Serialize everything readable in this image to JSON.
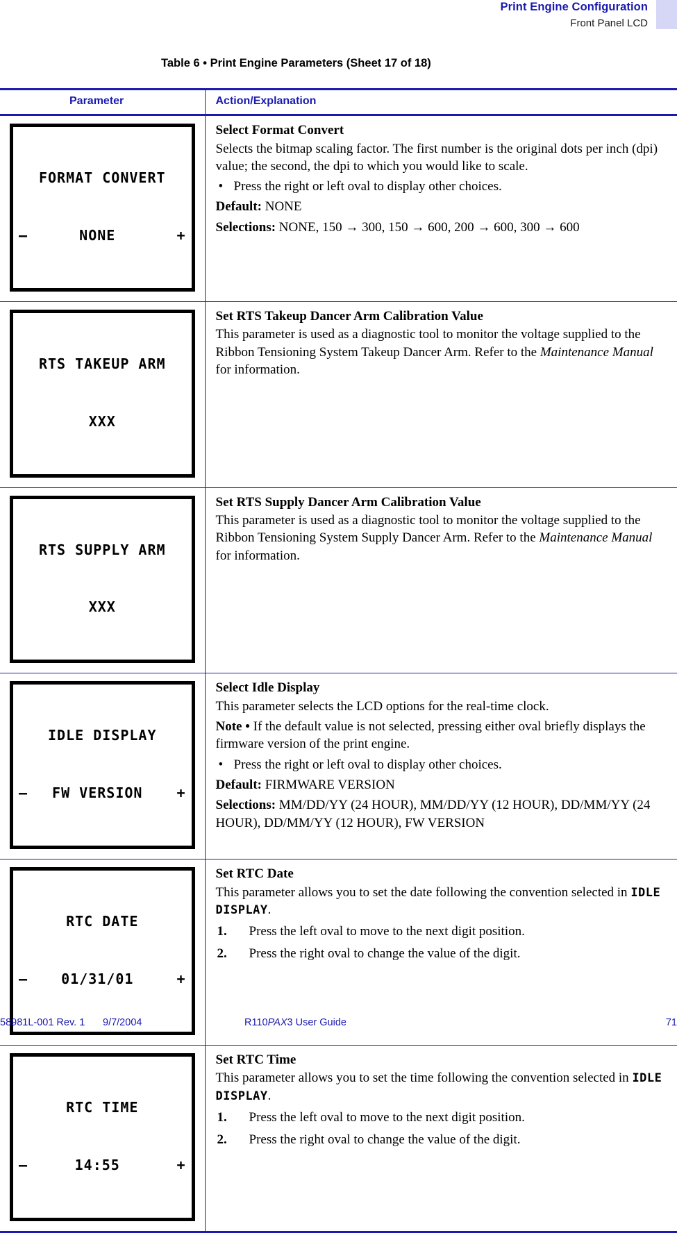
{
  "header": {
    "title": "Print Engine Configuration",
    "subtitle": "Front Panel LCD",
    "tab_color": "#d6d6f7",
    "accent_color": "#1a1ab0"
  },
  "table_title": "Table 6 • Print Engine Parameters (Sheet 17 of 18)",
  "columns": {
    "parameter": "Parameter",
    "action": "Action/Explanation"
  },
  "rows": [
    {
      "lcd": {
        "line1": "FORMAT CONVERT",
        "minus": "–",
        "value": "NONE",
        "plus": "+"
      },
      "heading": "Select Format Convert",
      "para1": "Selects the bitmap scaling factor. The first number is the original dots per inch (dpi) value; the second, the dpi to which you would like to scale.",
      "bullet1": "Press the right or left oval to display other choices.",
      "default_label": "Default:",
      "default_value": "NONE",
      "selections_label": "Selections:",
      "selections_value": "NONE, 150 → 300, 150 → 600, 200 → 600, 300 → 600"
    },
    {
      "lcd": {
        "line1": "RTS TAKEUP ARM",
        "line2": "XXX"
      },
      "heading": "Set RTS Takeup Dancer Arm Calibration Value",
      "para_pre": "This parameter is used as a diagnostic tool to monitor the voltage supplied to the Ribbon Tensioning System Takeup Dancer Arm. Refer to the ",
      "para_italic": "Maintenance Manual",
      "para_post": " for information."
    },
    {
      "lcd": {
        "line1": "RTS SUPPLY ARM",
        "line2": "XXX"
      },
      "heading": "Set RTS Supply Dancer Arm Calibration Value",
      "para_pre": "This parameter is used as a diagnostic tool to monitor the voltage supplied to the Ribbon Tensioning System Supply Dancer Arm. Refer to the ",
      "para_italic": "Maintenance Manual",
      "para_post": " for information."
    },
    {
      "lcd": {
        "line1": "IDLE DISPLAY",
        "minus": "–",
        "value": "FW VERSION",
        "plus": "+"
      },
      "heading": "Select Idle Display",
      "para1": "This parameter selects the LCD options for the real-time clock.",
      "note_label": "Note •",
      "note_text": "If the default value is not selected, pressing either oval briefly displays the firmware version of the print engine.",
      "bullet1": "Press the right or left oval to display other choices.",
      "default_label": "Default:",
      "default_value": "FIRMWARE VERSION",
      "selections_label": "Selections:",
      "selections_value": "MM/DD/YY (24 HOUR), MM/DD/YY (12 HOUR), DD/MM/YY (24 HOUR), DD/MM/YY (12 HOUR), FW VERSION"
    },
    {
      "lcd": {
        "line1": "RTC DATE",
        "minus": "–",
        "value": "01/31/01",
        "plus": "+"
      },
      "heading": "Set RTC Date",
      "para_pre": "This parameter allows you to set the date following the convention selected in ",
      "para_lcd": "IDLE DISPLAY",
      "para_post": ".",
      "steps": [
        {
          "num": "1.",
          "text": "Press the left oval to move to the next digit position."
        },
        {
          "num": "2.",
          "text": "Press the right oval to change the value of the digit."
        }
      ]
    },
    {
      "lcd": {
        "line1": "RTC TIME",
        "minus": "–",
        "value": "14:55",
        "plus": "+"
      },
      "heading": "Set RTC Time",
      "para_pre": "This parameter allows you to set the time following the convention selected in ",
      "para_lcd": "IDLE DISPLAY",
      "para_post": ".",
      "steps": [
        {
          "num": "1.",
          "text": "Press the left oval to move to the next digit position."
        },
        {
          "num": "2.",
          "text": "Press the right oval to change the value of the digit."
        }
      ]
    }
  ],
  "footer": {
    "doc_id": "58981L-001 Rev. 1",
    "date": "9/7/2004",
    "guide_pre": "R110",
    "guide_ital": "PAX",
    "guide_post": "3 User Guide",
    "page_number": "71"
  }
}
